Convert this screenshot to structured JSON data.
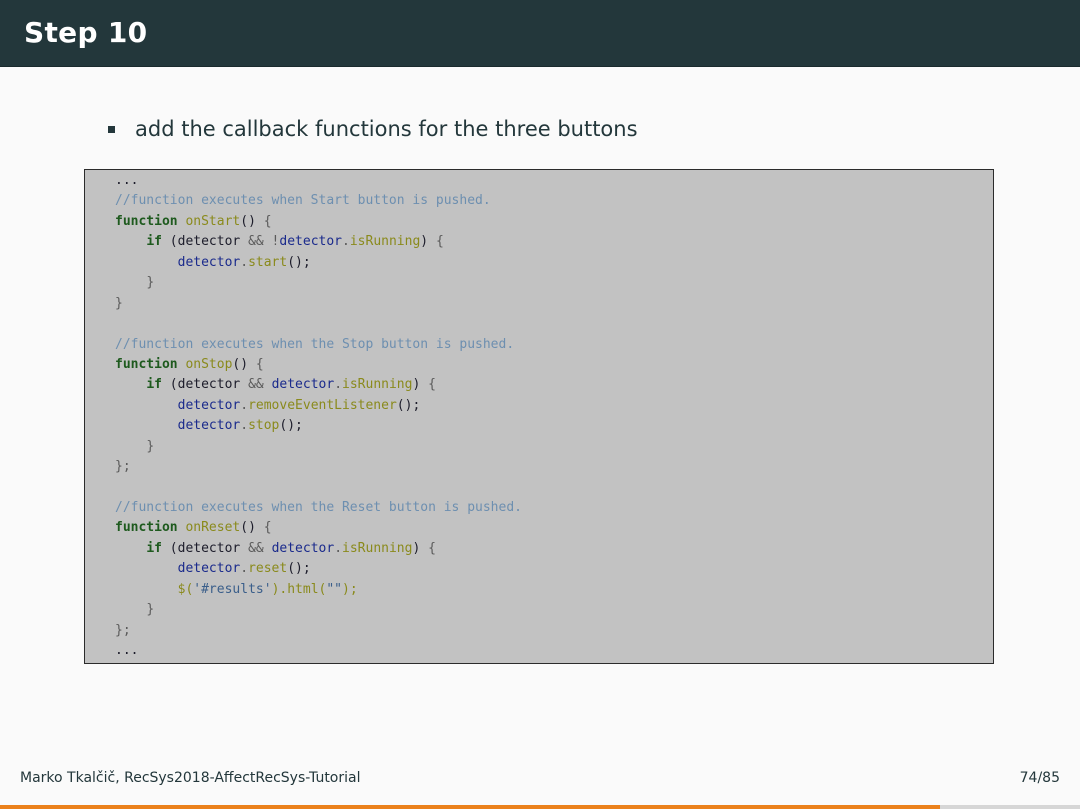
{
  "header": {
    "title": "Step 10"
  },
  "bullet": {
    "text": "add the callback functions for the three buttons"
  },
  "code": {
    "lines": [
      [
        [
          "plain",
          "..."
        ]
      ],
      [
        [
          "comment",
          "//function executes when Start button is pushed."
        ]
      ],
      [
        [
          "keyword",
          "function "
        ],
        [
          "func",
          "onStart"
        ],
        [
          "plain",
          "() "
        ],
        [
          "punct",
          "{"
        ]
      ],
      [
        [
          "plain",
          "    "
        ],
        [
          "keyword",
          "if "
        ],
        [
          "plain",
          "(detector "
        ],
        [
          "punct",
          "&& !"
        ],
        [
          "obj",
          "detector"
        ],
        [
          "punct",
          "."
        ],
        [
          "func",
          "isRunning"
        ],
        [
          "plain",
          ") "
        ],
        [
          "punct",
          "{"
        ]
      ],
      [
        [
          "plain",
          "        "
        ],
        [
          "obj",
          "detector"
        ],
        [
          "punct",
          "."
        ],
        [
          "func",
          "start"
        ],
        [
          "plain",
          "();"
        ]
      ],
      [
        [
          "plain",
          "    "
        ],
        [
          "punct",
          "}"
        ]
      ],
      [
        [
          "punct",
          "}"
        ]
      ],
      [
        [
          "plain",
          ""
        ]
      ],
      [
        [
          "comment",
          "//function executes when the Stop button is pushed."
        ]
      ],
      [
        [
          "keyword",
          "function "
        ],
        [
          "func",
          "onStop"
        ],
        [
          "plain",
          "() "
        ],
        [
          "punct",
          "{"
        ]
      ],
      [
        [
          "plain",
          "    "
        ],
        [
          "keyword",
          "if "
        ],
        [
          "plain",
          "(detector "
        ],
        [
          "punct",
          "&& "
        ],
        [
          "obj",
          "detector"
        ],
        [
          "punct",
          "."
        ],
        [
          "func",
          "isRunning"
        ],
        [
          "plain",
          ") "
        ],
        [
          "punct",
          "{"
        ]
      ],
      [
        [
          "plain",
          "        "
        ],
        [
          "obj",
          "detector"
        ],
        [
          "punct",
          "."
        ],
        [
          "func",
          "removeEventListener"
        ],
        [
          "plain",
          "();"
        ]
      ],
      [
        [
          "plain",
          "        "
        ],
        [
          "obj",
          "detector"
        ],
        [
          "punct",
          "."
        ],
        [
          "func",
          "stop"
        ],
        [
          "plain",
          "();"
        ]
      ],
      [
        [
          "plain",
          "    "
        ],
        [
          "punct",
          "}"
        ]
      ],
      [
        [
          "punct",
          "};"
        ]
      ],
      [
        [
          "plain",
          ""
        ]
      ],
      [
        [
          "comment",
          "//function executes when the Reset button is pushed."
        ]
      ],
      [
        [
          "keyword",
          "function "
        ],
        [
          "func",
          "onReset"
        ],
        [
          "plain",
          "() "
        ],
        [
          "punct",
          "{"
        ]
      ],
      [
        [
          "plain",
          "    "
        ],
        [
          "keyword",
          "if "
        ],
        [
          "plain",
          "(detector "
        ],
        [
          "punct",
          "&& "
        ],
        [
          "obj",
          "detector"
        ],
        [
          "punct",
          "."
        ],
        [
          "func",
          "isRunning"
        ],
        [
          "plain",
          ") "
        ],
        [
          "punct",
          "{"
        ]
      ],
      [
        [
          "plain",
          "        "
        ],
        [
          "obj",
          "detector"
        ],
        [
          "punct",
          "."
        ],
        [
          "func",
          "reset"
        ],
        [
          "plain",
          "();"
        ]
      ],
      [
        [
          "plain",
          "        "
        ],
        [
          "func",
          "$("
        ],
        [
          "string",
          "'#results'"
        ],
        [
          "func",
          ").html("
        ],
        [
          "string",
          "\"\""
        ],
        [
          "func",
          ");"
        ]
      ],
      [
        [
          "plain",
          "    "
        ],
        [
          "punct",
          "}"
        ]
      ],
      [
        [
          "punct",
          "};"
        ]
      ],
      [
        [
          "plain",
          "..."
        ]
      ]
    ]
  },
  "footer": {
    "left": "Marko Tkalčič, RecSys2018-AffectRecSys-Tutorial",
    "page": "74/85"
  },
  "progress": {
    "fraction": 0.8706
  },
  "colors": {
    "header_bg": "#23373b",
    "code_bg": "#c2c2c2",
    "progress_accent": "#eb811b"
  }
}
